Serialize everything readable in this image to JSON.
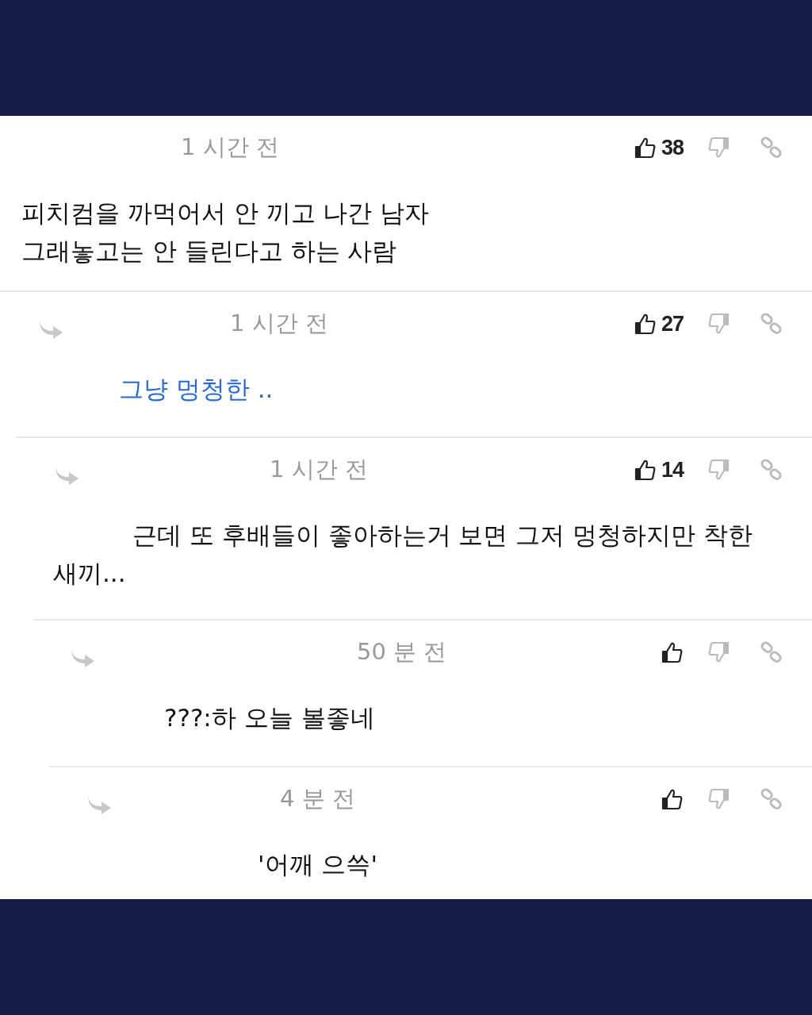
{
  "comments": [
    {
      "time": "1 시간 전",
      "likes": "38",
      "body": "피치컴을 까먹어서 안 끼고 나간 남자\n그래놓고는 안 들린다고 하는 사람",
      "link": false,
      "children": [
        {
          "time": "1 시간 전",
          "likes": "27",
          "body": "그냥 멍청한 ..",
          "link": true,
          "children": [
            {
              "time": "1 시간 전",
              "likes": "14",
              "body": "근데 또 후배들이 좋아하는거 보면 그저 멍청하지만 착한 새끼...",
              "link": false,
              "children": [
                {
                  "time": "50 분 전",
                  "body": "???:하 오늘 볼좋네",
                  "link": false,
                  "children": [
                    {
                      "time": "4 분 전",
                      "body": "'어깨 으쓱'",
                      "link": false
                    }
                  ]
                }
              ]
            }
          ]
        }
      ]
    }
  ]
}
